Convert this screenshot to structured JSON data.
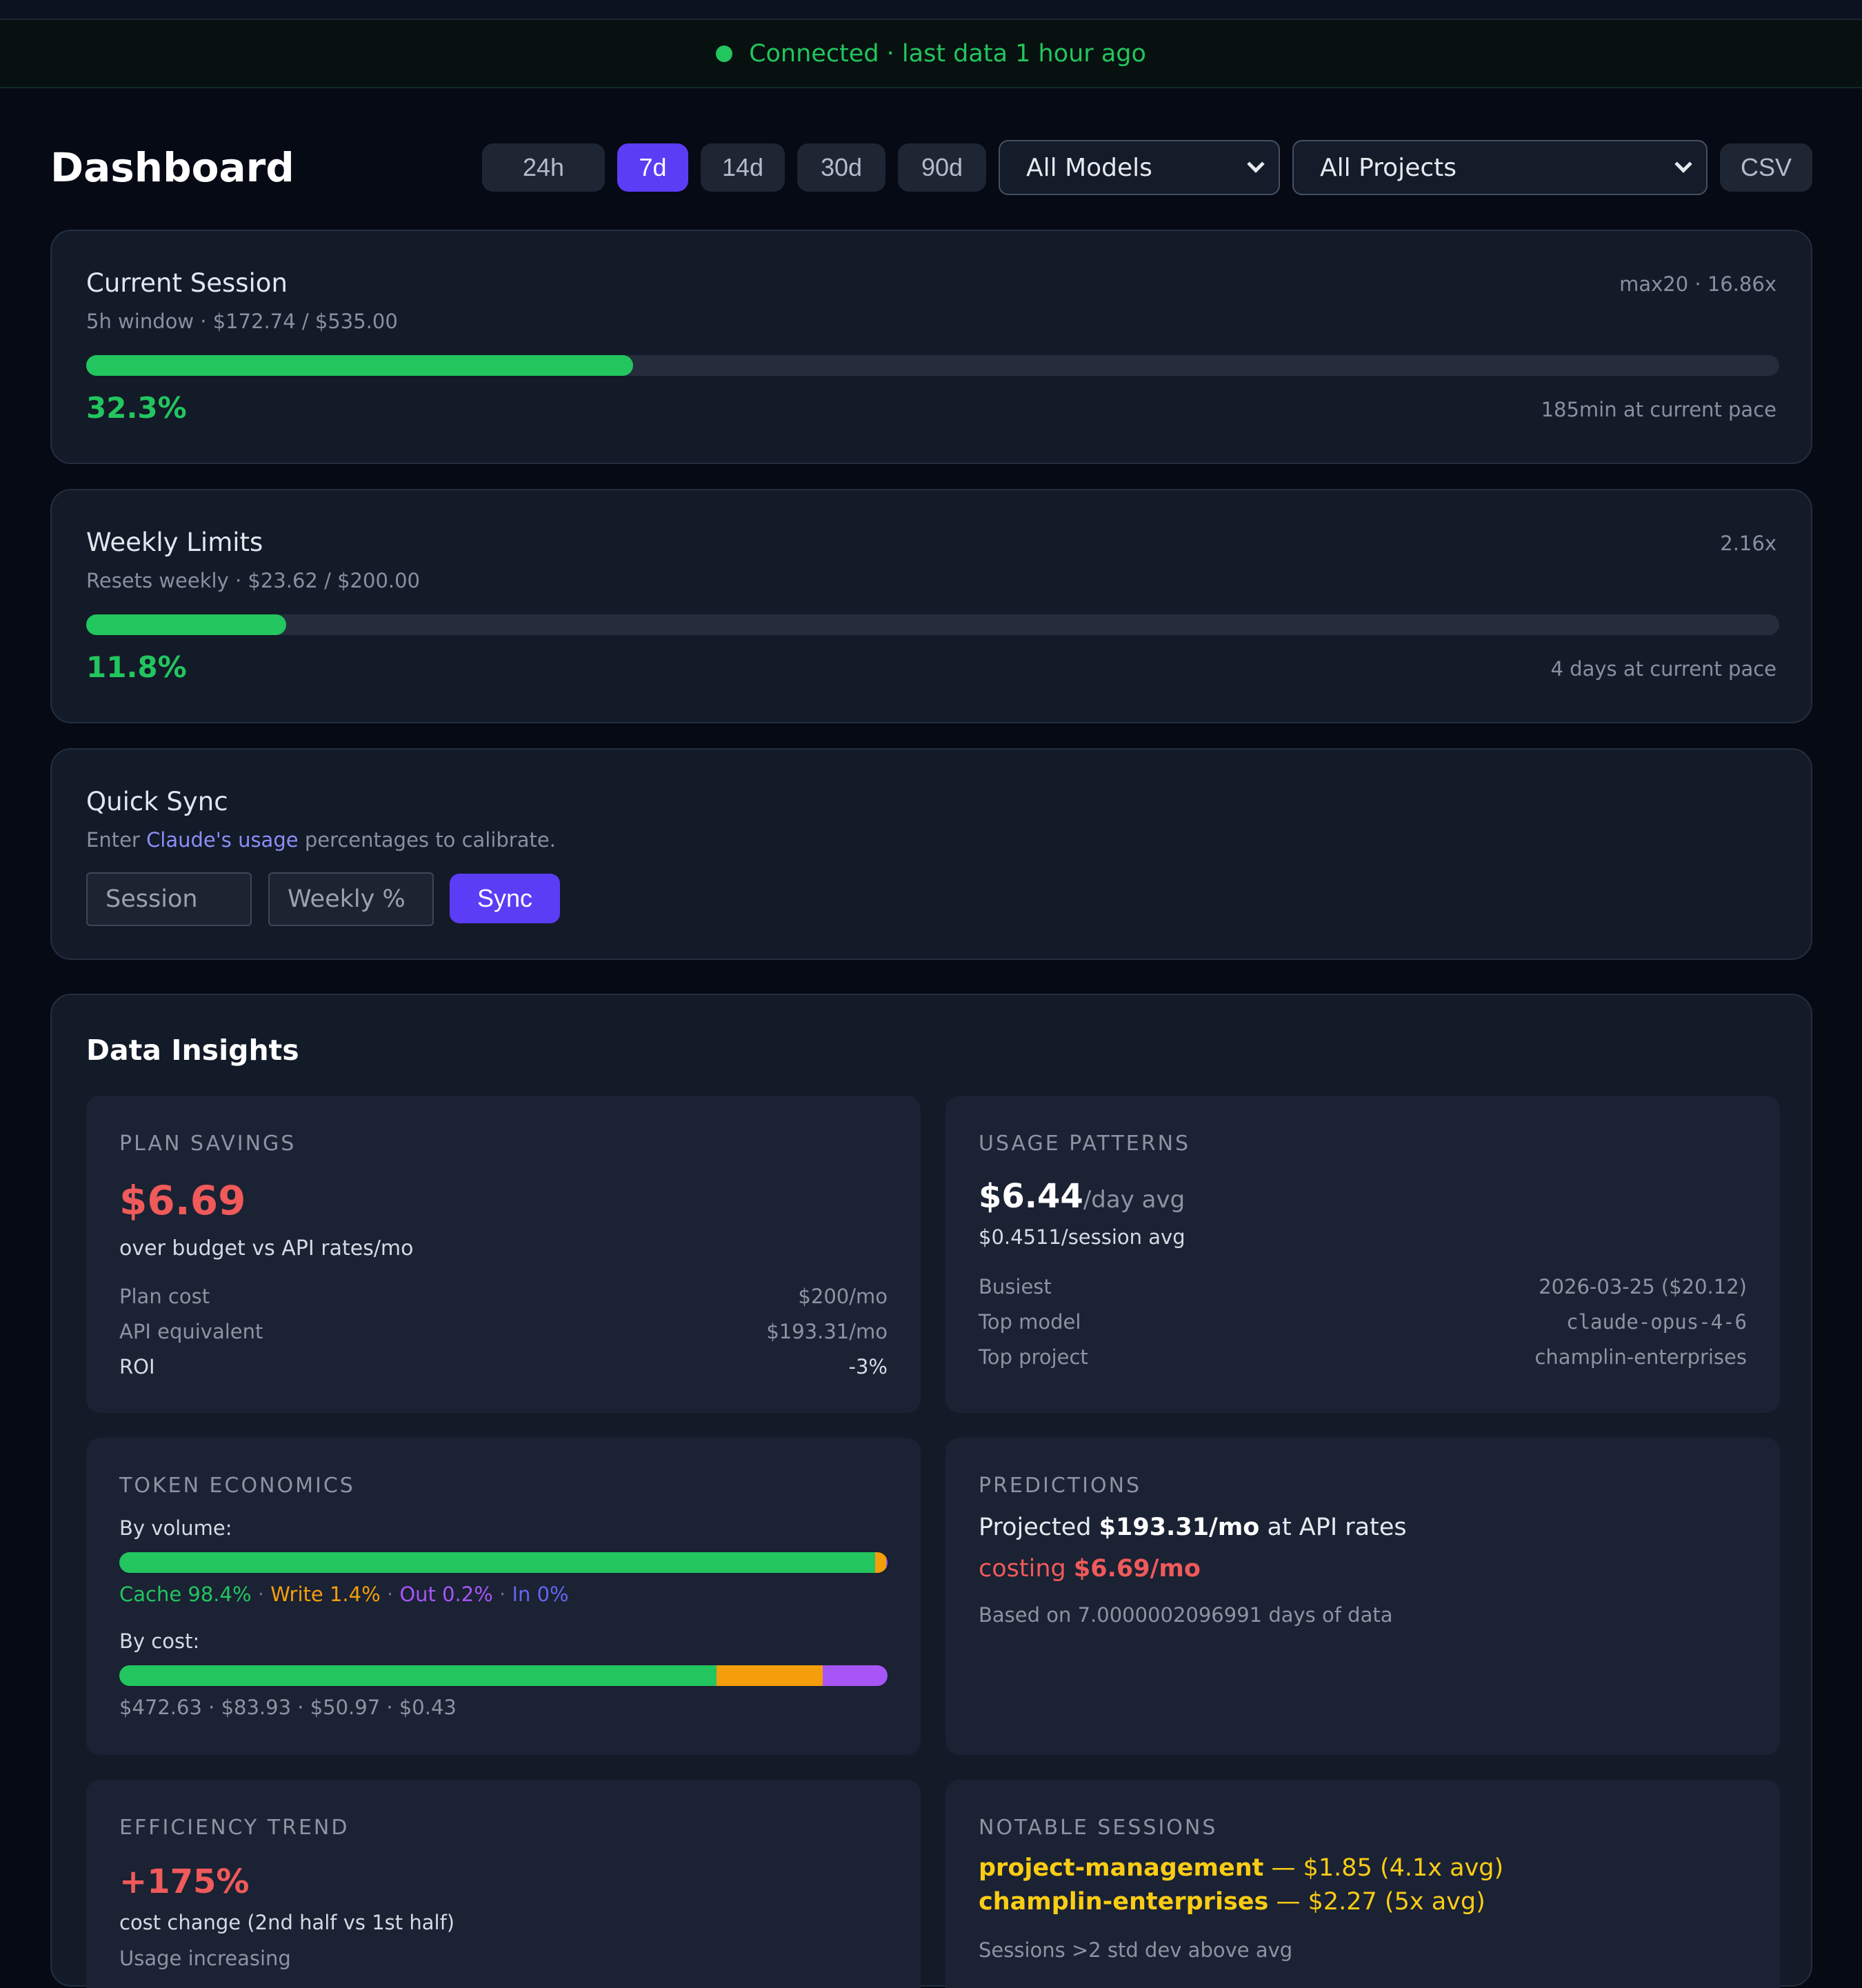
{
  "status": {
    "text": "Connected · last data 1 hour ago",
    "color": "#22c55e"
  },
  "header": {
    "title": "Dashboard",
    "ranges": [
      "24h",
      "7d",
      "14d",
      "30d",
      "90d"
    ],
    "active_range": "7d",
    "model_select": "All Models",
    "project_select": "All Projects",
    "csv_label": "CSV"
  },
  "session_card": {
    "title": "Current Session",
    "subtitle": "5h window · $172.74 / $535.00",
    "right_info": "max20 · 16.86x",
    "percent_label": "32.3%",
    "progress": 0.323,
    "pace": "185min at current pace"
  },
  "weekly_card": {
    "title": "Weekly Limits",
    "subtitle": "Resets weekly · $23.62 / $200.00",
    "right_info": "2.16x",
    "percent_label": "11.8%",
    "progress": 0.118,
    "pace": "4 days at current pace"
  },
  "quick_sync": {
    "title": "Quick Sync",
    "desc_prefix": "Enter",
    "desc_link": "Claude's usage",
    "desc_suffix": "percentages to calibrate.",
    "session_placeholder": "Session",
    "weekly_placeholder": "Weekly %",
    "sync_label": "Sync"
  },
  "insights": {
    "title": "Data Insights",
    "plan_savings": {
      "label": "PLAN SAVINGS",
      "value": "$6.69",
      "caption": "over budget vs API rates/mo",
      "rows": [
        {
          "key": "Plan cost",
          "value": "$200/mo"
        },
        {
          "key": "API equivalent",
          "value": "$193.31/mo"
        },
        {
          "key": "ROI",
          "value": "-3%"
        }
      ]
    },
    "usage_patterns": {
      "label": "USAGE PATTERNS",
      "value": "$6.44",
      "unit": "/day avg",
      "caption": "$0.4511/session avg",
      "rows": [
        {
          "key": "Busiest",
          "value": "2026-03-25 ($20.12)"
        },
        {
          "key": "Top model",
          "value": "claude-opus-4-6"
        },
        {
          "key": "Top project",
          "value": "champlin-enterprises"
        }
      ]
    },
    "token_economics": {
      "label": "TOKEN ECONOMICS",
      "by_volume_label": "By volume:",
      "volume": [
        {
          "name": "Cache",
          "text": "Cache 98.4%",
          "fraction": 0.984,
          "color": "#22c55e"
        },
        {
          "name": "Write",
          "text": "Write 1.4%",
          "fraction": 0.014,
          "color": "#f59e0b"
        },
        {
          "name": "Out",
          "text": "Out 0.2%",
          "fraction": 0.002,
          "color": "#a855f7"
        },
        {
          "name": "In",
          "text": "In 0%",
          "fraction": 0.0,
          "color": "#6366f1"
        }
      ],
      "by_cost_label": "By cost:",
      "cost": [
        {
          "value": 472.63,
          "color": "#22c55e"
        },
        {
          "value": 83.93,
          "color": "#f59e0b"
        },
        {
          "value": 50.97,
          "color": "#a855f7"
        },
        {
          "value": 0.43,
          "color": "#6366f1"
        }
      ],
      "cost_caption": "$472.63 · $83.93 · $50.97 · $0.43"
    },
    "predictions": {
      "label": "PREDICTIONS",
      "line1_prefix": "Projected",
      "line1_value": "$193.31/mo",
      "line1_suffix": "at API rates",
      "line2_prefix": "costing",
      "line2_value": "$6.69/mo",
      "caption": "Based on 7.0000002096991 days of data"
    },
    "efficiency": {
      "label": "EFFICIENCY TREND",
      "value": "+175%",
      "caption": "cost change (2nd half vs 1st half)",
      "note": "Usage increasing"
    },
    "notable": {
      "label": "NOTABLE SESSIONS",
      "items": [
        {
          "name": "project-management",
          "detail": "— $1.85 (4.1x avg)"
        },
        {
          "name": "champlin-enterprises",
          "detail": "— $2.27 (5x avg)"
        }
      ],
      "caption": "Sessions >2 std dev above avg"
    }
  },
  "colors": {
    "accent": "#5b3df5",
    "good": "#22c55e",
    "bad": "#f05a5a",
    "warn": "#facc15"
  }
}
